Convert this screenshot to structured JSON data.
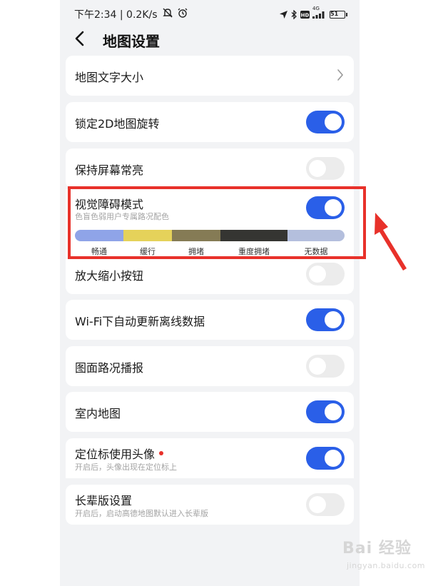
{
  "status_bar": {
    "time_speed": "下午2:34 | 0.2K/s",
    "battery": "51",
    "network": "4G"
  },
  "header": {
    "title": "地图设置"
  },
  "settings": [
    {
      "label": "地图文字大小",
      "type": "nav"
    },
    {
      "label": "锁定2D地图旋转",
      "type": "toggle",
      "enabled": true
    },
    {
      "label": "保持屏幕常亮",
      "type": "toggle",
      "enabled": false
    },
    {
      "label": "视觉障碍模式",
      "sublabel": "色盲色弱用户专属路况配色",
      "type": "toggle",
      "enabled": true,
      "legend": [
        {
          "label": "畅通",
          "color": "#8fa4e8"
        },
        {
          "label": "缓行",
          "color": "#e5d25a"
        },
        {
          "label": "拥堵",
          "color": "#857b55"
        },
        {
          "label": "重度拥堵",
          "color": "#353532"
        },
        {
          "label": "无数据",
          "color": "#b4bfdd"
        }
      ]
    },
    {
      "label": "放大缩小按钮",
      "type": "toggle",
      "enabled": false
    },
    {
      "label": "Wi-Fi下自动更新离线数据",
      "type": "toggle",
      "enabled": true
    },
    {
      "label": "图面路况播报",
      "type": "toggle",
      "enabled": false
    },
    {
      "label": "室内地图",
      "type": "toggle",
      "enabled": true
    },
    {
      "label": "定位标使用头像",
      "sublabel": "开启后，头像出现在定位标上",
      "type": "toggle",
      "enabled": true,
      "new_dot": true
    },
    {
      "label": "长辈版设置",
      "sublabel": "开启后，启动高德地图默认进入长辈版",
      "type": "toggle",
      "enabled": false
    }
  ],
  "colors": {
    "toggle_on": "#2a5fe8",
    "toggle_off": "#ececec",
    "highlight": "#e8312a"
  },
  "watermark": {
    "text": "Bai 经验",
    "url": "jingyan.baidu.com"
  }
}
